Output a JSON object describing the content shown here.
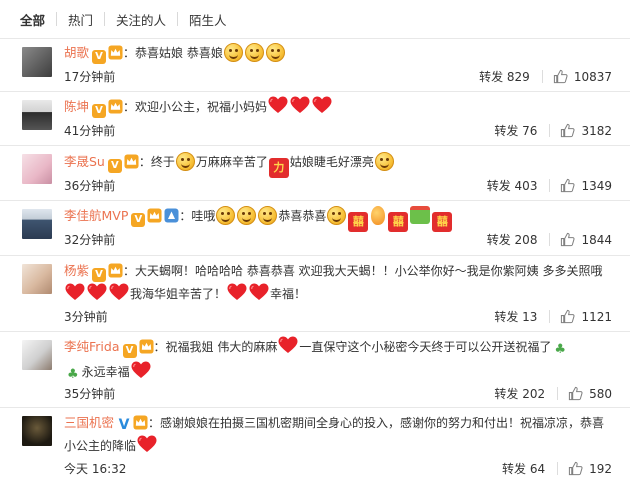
{
  "tabs": {
    "all": "全部",
    "hot": "热门",
    "following": "关注的人",
    "strangers": "陌生人"
  },
  "repost_label": "转发",
  "colors": {
    "name": "#eb7350",
    "badge_orange": "#f5a623",
    "badge_blue": "#2a8bdc",
    "heart": "#e8222a"
  },
  "comments": [
    {
      "name": "胡歌",
      "pre": "：恭喜姑娘 恭喜娘",
      "post": "",
      "time": "17分钟前",
      "reposts": "829",
      "likes": "10837"
    },
    {
      "name": "陈坤",
      "pre": "：欢迎小公主，祝福小妈妈",
      "post": "",
      "time": "41分钟前",
      "reposts": "76",
      "likes": "3182"
    },
    {
      "name": "李晟Su",
      "pre": "：终于",
      "mid1": "万麻麻辛苦了",
      "mid2": "姑娘睫毛好漂亮",
      "time": "36分钟前",
      "reposts": "403",
      "likes": "1349",
      "badge_char": "力"
    },
    {
      "name": "李佳航MVP",
      "pre": "：哇哦",
      "mid1": "恭喜恭喜",
      "time": "32分钟前",
      "reposts": "208",
      "likes": "1844",
      "red_char": "囍"
    },
    {
      "name": "杨紫",
      "pre": "：大天蝎啊！哈哈哈哈 恭喜恭喜 欢迎我大天蝎！！小公举你好～我是你紫阿姨 多多关照哦",
      "mid1": "我海华姐辛苦了！",
      "mid2": "幸福！",
      "time": "3分钟前",
      "reposts": "13",
      "likes": "1121"
    },
    {
      "name": "李纯Frida",
      "pre": "：祝福我姐 伟大的麻麻",
      "mid1": "一直保守这个小秘密今天终于可以公开送祝福了",
      "mid2": "永远幸福",
      "time": "35分钟前",
      "reposts": "202",
      "likes": "580"
    },
    {
      "name": "三国机密",
      "pre": "：感谢娘娘在拍摄三国机密期间全身心的投入，感谢你的努力和付出！祝福凉凉，恭喜小公主的降临",
      "time": "今天 16:32",
      "reposts": "64",
      "likes": "192"
    }
  ]
}
